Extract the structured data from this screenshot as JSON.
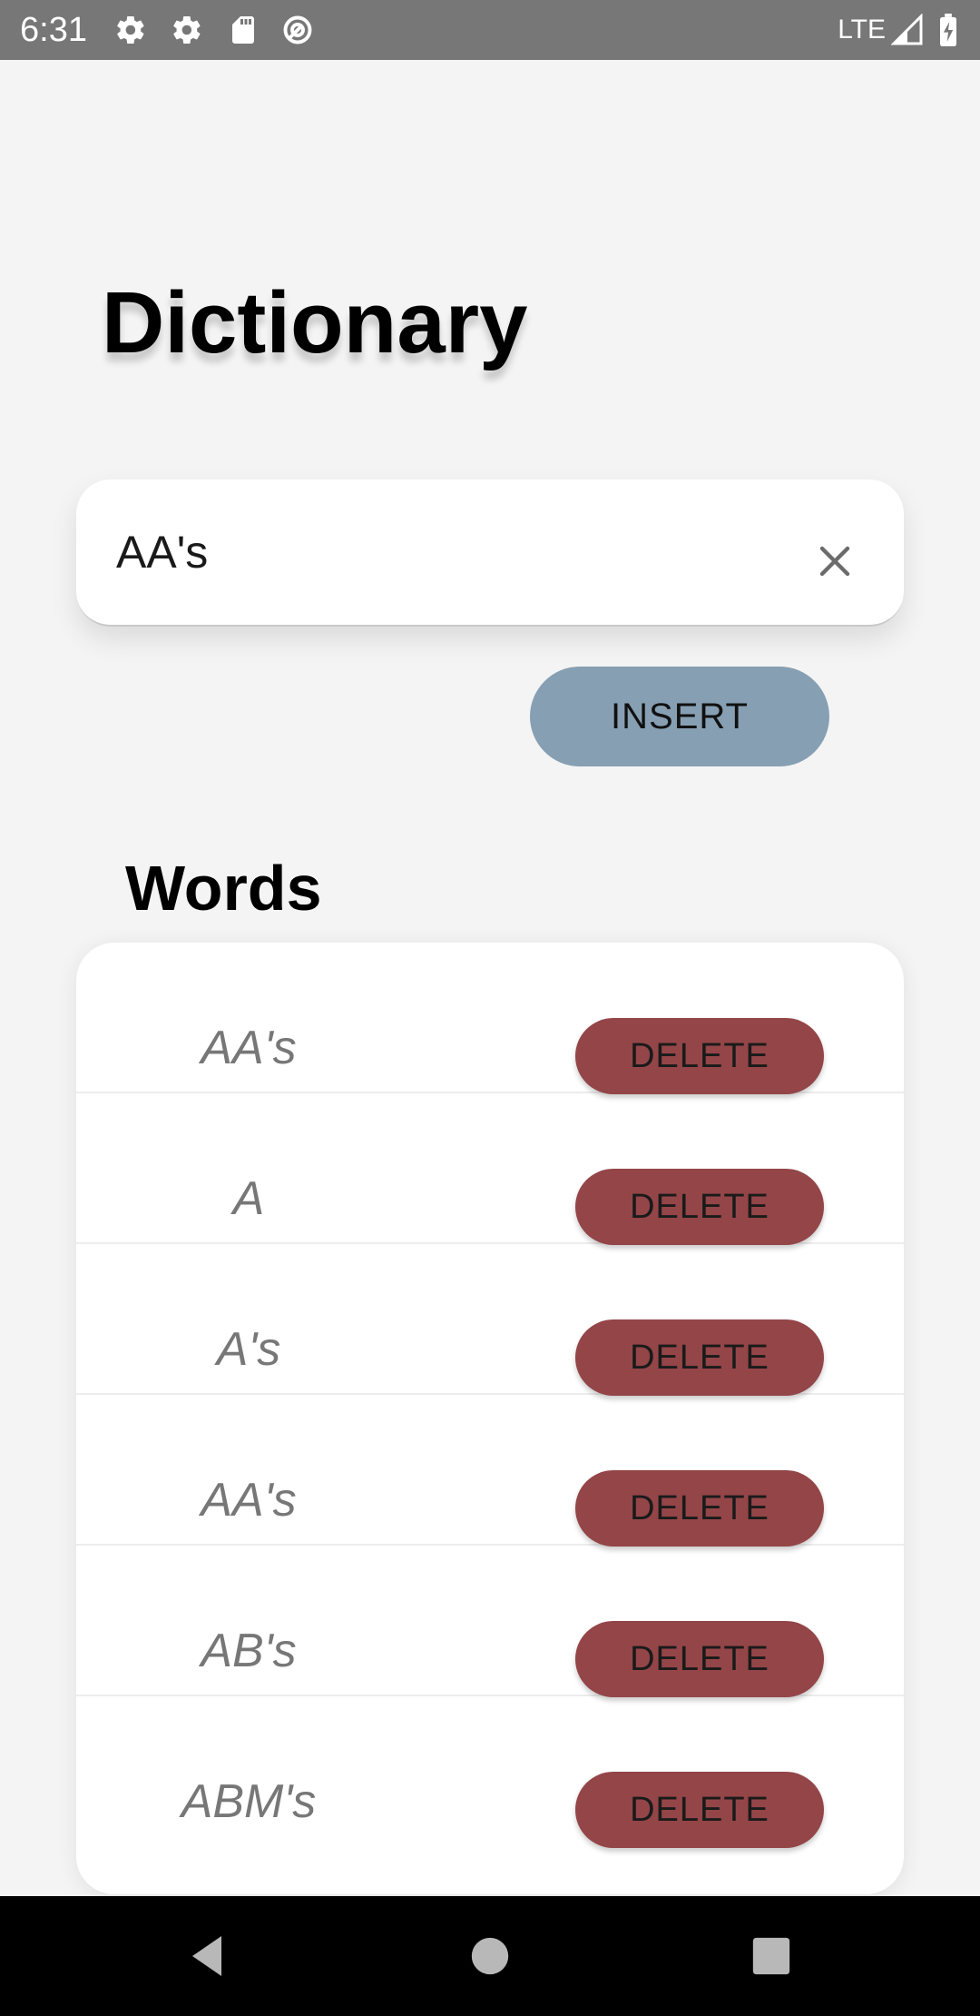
{
  "status_bar": {
    "time": "6:31",
    "network": "LTE",
    "icons": [
      "settings-icon",
      "settings-icon",
      "sd-card-icon",
      "sync-icon",
      "signal-icon",
      "battery-charging-icon"
    ]
  },
  "app": {
    "title": "Dictionary"
  },
  "search": {
    "value": "AA's",
    "clear_icon": "close-icon"
  },
  "actions": {
    "insert_label": "INSERT"
  },
  "words_section": {
    "heading": "Words",
    "items": [
      {
        "word": "AA's",
        "delete_label": "DELETE"
      },
      {
        "word": "A",
        "delete_label": "DELETE"
      },
      {
        "word": "A's",
        "delete_label": "DELETE"
      },
      {
        "word": "AA's",
        "delete_label": "DELETE"
      },
      {
        "word": "AB's",
        "delete_label": "DELETE"
      },
      {
        "word": "ABM's",
        "delete_label": "DELETE"
      }
    ]
  },
  "navigation": {
    "icons": [
      "back-icon",
      "home-icon",
      "recents-icon"
    ]
  },
  "colors": {
    "insert_button": "#879fb3",
    "delete_button": "#934548",
    "status_bar": "#777777",
    "background": "#f4f4f4"
  }
}
